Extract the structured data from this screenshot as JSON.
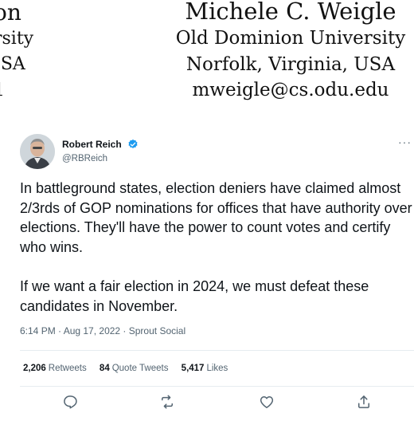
{
  "paper": {
    "left_author": {
      "name_fragment": "on",
      "affiliation_fragment": "rsity",
      "location_fragment": "JSA",
      "email_fragment": "1"
    },
    "right_author": {
      "name": "Michele C. Weigle",
      "affiliation": "Old Dominion University",
      "location": "Norfolk, Virginia, USA",
      "email": "mweigle@cs.odu.edu"
    }
  },
  "tweet": {
    "author_name": "Robert Reich",
    "handle": "@RBReich",
    "paragraphs": [
      "In battleground states, election deniers have claimed almost 2/3rds of GOP nominations for offices that have authority over elections. They'll have the power to count votes and certify who wins.",
      "If we want a fair election in 2024, we must defeat these candidates in November."
    ],
    "timestamp": "6:14 PM · Aug 17, 2022 · Sprout Social",
    "stats": {
      "retweets_count": "2,206",
      "retweets_label": "Retweets",
      "quotes_count": "84",
      "quotes_label": "Quote Tweets",
      "likes_count": "5,417",
      "likes_label": "Likes"
    },
    "more_glyph": "···",
    "icons": [
      "reply-icon",
      "retweet-icon",
      "like-icon",
      "share-icon"
    ],
    "colors": {
      "verified": "#1d9bf0",
      "secondary_text": "#536471",
      "primary_text": "#0f1419"
    }
  }
}
